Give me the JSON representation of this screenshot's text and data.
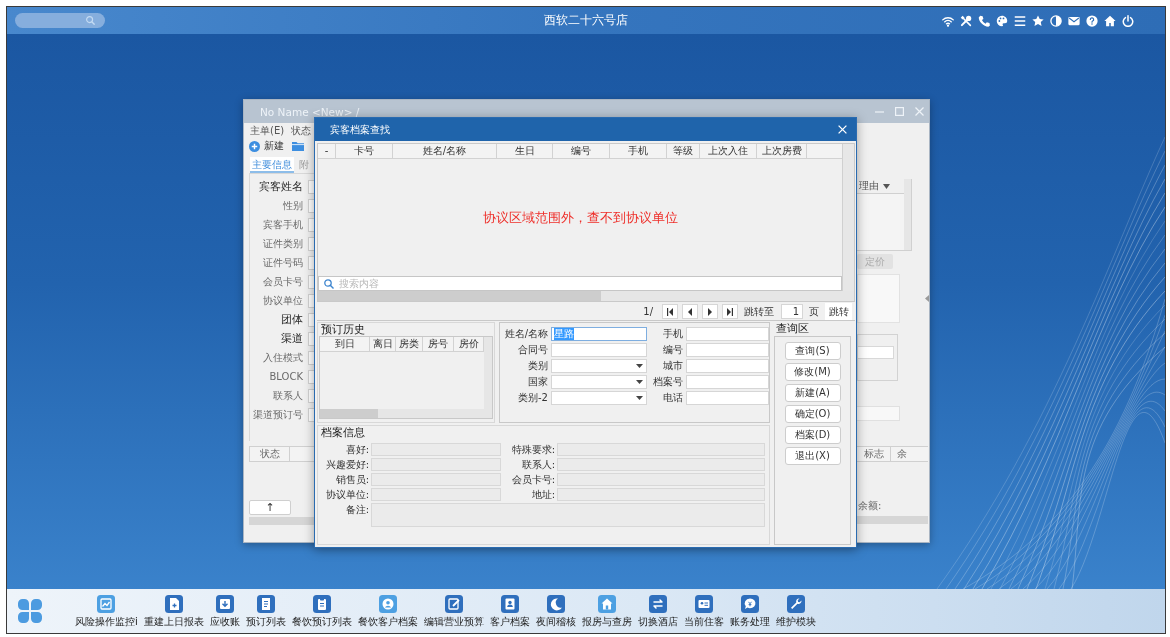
{
  "top_bar": {
    "title": "西软二十六号店"
  },
  "main_window": {
    "title": "No Name <New> /",
    "menu": [
      "主单(E)",
      "状态"
    ],
    "toolbar": {
      "new_button": "新建"
    },
    "tabs": [
      {
        "label": "主要信息",
        "selected": true
      },
      {
        "label": "附",
        "selected": false
      }
    ],
    "fields": [
      {
        "label": "宾客姓名",
        "emphasized": true
      },
      {
        "label": "性别",
        "emphasized": false
      },
      {
        "label": "宾客手机",
        "emphasized": false
      },
      {
        "label": "证件类别",
        "emphasized": false
      },
      {
        "label": "证件号码",
        "emphasized": false
      },
      {
        "label": "会员卡号",
        "emphasized": false
      },
      {
        "label": "协议单位",
        "emphasized": false
      },
      {
        "label": "团体",
        "emphasized": true
      },
      {
        "label": "渠道",
        "emphasized": true
      },
      {
        "label": "入住模式",
        "emphasized": false
      },
      {
        "label": "BLOCK",
        "emphasized": false
      },
      {
        "label": "联系人",
        "emphasized": false
      },
      {
        "label": "渠道预订号",
        "emphasized": false
      }
    ],
    "side_panel": {
      "column_header": "理由",
      "price_button": "定价"
    },
    "lower_table": {
      "columns": [
        "状态"
      ],
      "up_button": "↑"
    },
    "lower_right": {
      "columns": [
        "标志",
        "余"
      ],
      "balance_label": "余额:"
    }
  },
  "dialog": {
    "title": "宾客档案查找",
    "results": {
      "columns": [
        "-",
        "卡号",
        "姓名/名称",
        "生日",
        "编号",
        "手机",
        "等级",
        "上次入住",
        "上次房费"
      ],
      "message": "协议区域范围外，查不到协议单位"
    },
    "search": {
      "placeholder": "搜索内容"
    },
    "pager": {
      "page": "1/",
      "jump_label": "跳转至",
      "page_input": "1",
      "page_unit": "页",
      "jump_button": "跳转"
    },
    "history": {
      "title": "预订历史",
      "columns": [
        "到日",
        "离日",
        "房类",
        "房号",
        "房价"
      ]
    },
    "criteria": [
      {
        "label": "姓名/名称",
        "kind": "text",
        "value": "星路",
        "focused": true
      },
      {
        "label": "手机",
        "kind": "text",
        "focused": false
      },
      {
        "label": "合同号",
        "kind": "text",
        "focused": false
      },
      {
        "label": "编号",
        "kind": "text",
        "focused": false
      },
      {
        "label": "类别",
        "kind": "dropdown",
        "focused": false
      },
      {
        "label": "城市",
        "kind": "text",
        "focused": false
      },
      {
        "label": "国家",
        "kind": "dropdown",
        "focused": false
      },
      {
        "label": "档案号",
        "kind": "text",
        "focused": false
      },
      {
        "label": "类别-2",
        "kind": "dropdown",
        "focused": false
      },
      {
        "label": "电话",
        "kind": "text",
        "focused": false
      }
    ],
    "actions": {
      "title": "查询区",
      "buttons": [
        "查询(S)",
        "修改(M)",
        "新建(A)",
        "确定(O)",
        "档案(D)",
        "退出(X)"
      ]
    },
    "profile": {
      "title": "档案信息",
      "fields": [
        {
          "label": "喜好:",
          "kind": "line",
          "disabled": true
        },
        {
          "label": "特殊要求:",
          "kind": "line",
          "disabled": true
        },
        {
          "label": "兴趣爱好:",
          "kind": "line",
          "disabled": true
        },
        {
          "label": "联系人:",
          "kind": "line",
          "disabled": true
        },
        {
          "label": "销售员:",
          "kind": "line",
          "disabled": true
        },
        {
          "label": "会员卡号:",
          "kind": "line",
          "disabled": true
        },
        {
          "label": "协议单位:",
          "kind": "line",
          "disabled": true
        },
        {
          "label": "地址:",
          "kind": "line",
          "disabled": true
        },
        {
          "label": "备注:",
          "kind": "area",
          "disabled": true
        }
      ]
    }
  },
  "taskbar": {
    "items": [
      "风险操作监控i",
      "重建上日报表",
      "应收账",
      "预订列表",
      "餐饮预订列表",
      "餐饮客户档案",
      "编辑营业预算",
      "客户档案",
      "夜间稽核",
      "报房与查房",
      "切换酒店",
      "当前住客",
      "账务处理",
      "维护模块"
    ]
  }
}
